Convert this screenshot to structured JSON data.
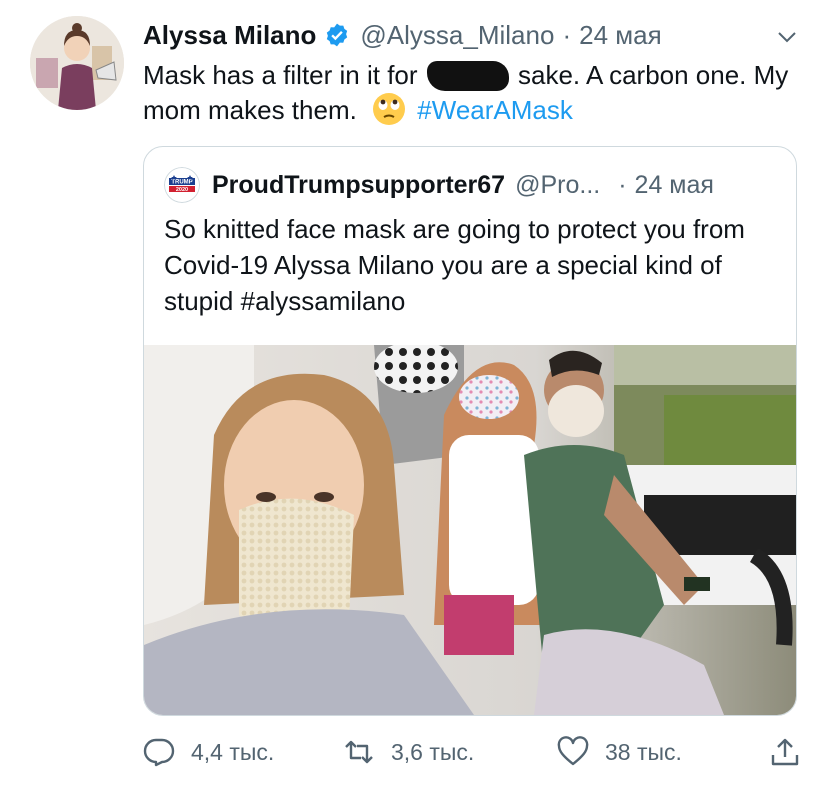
{
  "tweet": {
    "author_name": "Alyssa Milano",
    "handle": "@Alyssa_Milano",
    "separator": "·",
    "date": "24 мая",
    "text_part1": "Mask has a filter in it for",
    "text_part2": "sake. A carbon one. My mom makes them.",
    "hashtag": "#WearAMask"
  },
  "quoted": {
    "author_name": "ProudTrumpsupporter67",
    "handle": "@Pro...",
    "separator": "·",
    "date": "24 мая",
    "text": "So knitted face mask are going to protect you from Covid-19 Alyssa Milano you are a special kind of stupid #alyssamilano",
    "avatar_text_1": "TRUMP",
    "avatar_text_2": "2020"
  },
  "actions": {
    "replies": "4,4 тыс.",
    "retweets": "3,6 тыс.",
    "likes": "38 тыс."
  },
  "icons": {
    "verified": "verified-badge-icon",
    "more": "chevron-down-icon",
    "emoji": "face-with-rolling-eyes-icon",
    "reply": "reply-icon",
    "retweet": "retweet-icon",
    "like": "heart-icon",
    "share": "share-icon"
  },
  "colors": {
    "accent": "#1d9bf0",
    "text": "#0f1419",
    "muted": "#536471",
    "border": "#cfd9de"
  }
}
